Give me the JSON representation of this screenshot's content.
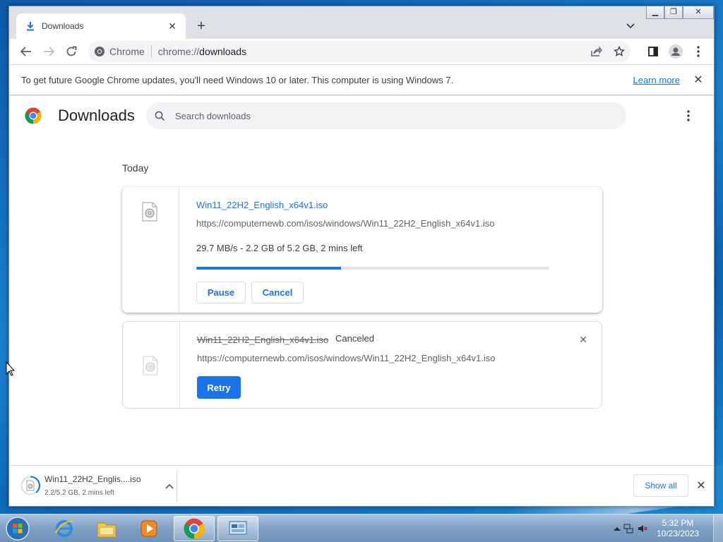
{
  "browser": {
    "tab": {
      "title": "Downloads",
      "icon": "download-icon"
    },
    "omnibox": {
      "site_label": "Chrome",
      "url_scheme": "chrome://",
      "url_host": "downloads"
    }
  },
  "infobar": {
    "message": "To get future Google Chrome updates, you'll need Windows 10 or later. This computer is using Windows 7.",
    "link": "Learn more"
  },
  "page": {
    "title": "Downloads",
    "search_placeholder": "Search downloads",
    "section_date": "Today",
    "downloads": [
      {
        "filename": "Win11_22H2_English_x64v1.iso",
        "url": "https://computernewb.com/isos/windows/Win11_22H2_English_x64v1.iso",
        "progress_text": "29.7 MB/s - 2.2 GB of 5.2 GB, 2 mins left",
        "progress_fraction": 0.41,
        "buttons": [
          "Pause",
          "Cancel"
        ]
      },
      {
        "filename": "Win11_22H2_English_x64v1.iso",
        "status": "Canceled",
        "url": "https://computernewb.com/isos/windows/Win11_22H2_English_x64v1.iso",
        "button": "Retry"
      }
    ]
  },
  "shelf": {
    "filename": "Win11_22H2_Englis....iso",
    "status": "2.2/5.2 GB, 2 mins left",
    "show_all": "Show all"
  },
  "taskbar": {
    "apps": [
      "start-orb",
      "internet-explorer",
      "windows-explorer",
      "media-player",
      "google-chrome",
      "control-panel"
    ],
    "time": "5:32 PM",
    "date": "10/23/2023"
  },
  "colors": {
    "accent": "#1a73e8",
    "taskbar": "#7f9fc4",
    "desktop": "#1b7fd0"
  }
}
